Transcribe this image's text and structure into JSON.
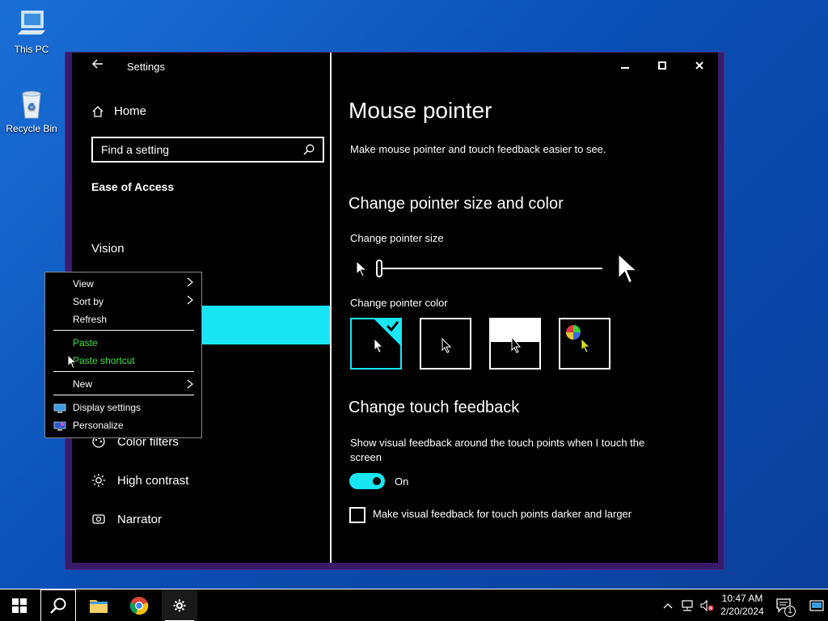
{
  "desktop": {
    "icons": [
      {
        "label": "This PC",
        "icon": "computer-icon"
      },
      {
        "label": "Recycle Bin",
        "icon": "recycle-bin-icon"
      }
    ]
  },
  "window": {
    "title": "Settings",
    "controls": {
      "minimize": "—",
      "maximize": "☐",
      "close": "✕"
    }
  },
  "nav": {
    "home_label": "Home",
    "search_placeholder": "Find a setting",
    "group_title": "Ease of Access",
    "section_vision": "Vision",
    "items": {
      "color_filters": "Color filters",
      "high_contrast": "High contrast",
      "narrator": "Narrator"
    }
  },
  "content": {
    "title": "Mouse pointer",
    "description": "Make mouse pointer and touch feedback easier to see.",
    "pointer_section": "Change pointer size and color",
    "size_label": "Change pointer size",
    "size_level": 0.0,
    "color_label": "Change pointer color",
    "color_options": [
      "white",
      "black",
      "inverted",
      "custom"
    ],
    "selected_color_option": "white",
    "touch_section": "Change touch feedback",
    "touch_desc_line1": "Show visual feedback around the touch points when I touch the",
    "touch_desc_line2": "screen",
    "toggle_state": "On",
    "checkbox_label": "Make visual feedback for touch points darker and larger"
  },
  "context_menu": {
    "view": "View",
    "sort_by": "Sort by",
    "refresh": "Refresh",
    "paste": "Paste",
    "paste_shortcut": "Paste shortcut",
    "new": "New",
    "display_settings": "Display settings",
    "personalize": "Personalize"
  },
  "taskbar": {
    "time": "10:47 AM",
    "date": "2/20/2024",
    "notification_count": "1"
  },
  "colors": {
    "accent": "#19e6f5",
    "disabled_green": "#3fe33f",
    "desktop_blue": "#0b5cc9",
    "frame_purple": "#3a1a6a"
  }
}
